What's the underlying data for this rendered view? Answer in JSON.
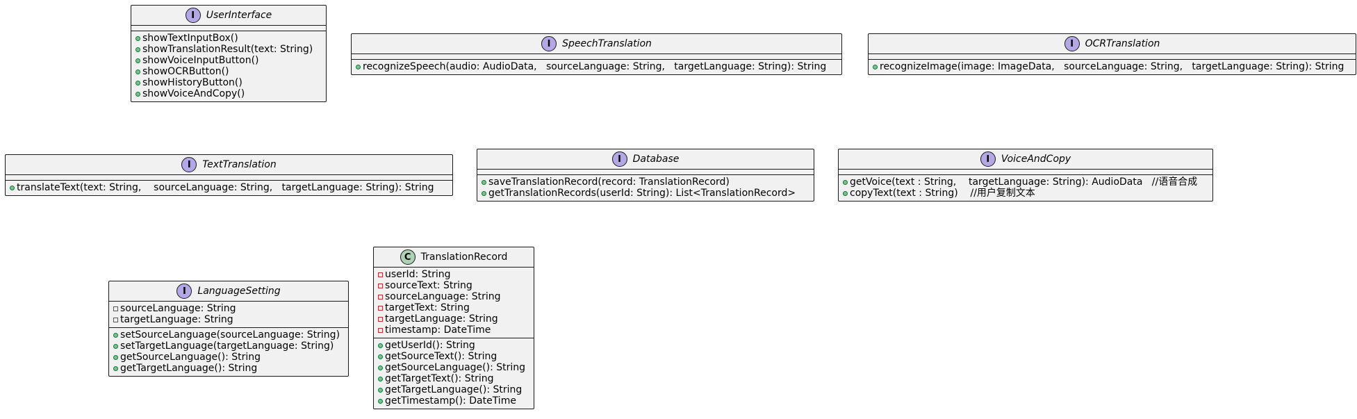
{
  "diagram": {
    "classes": [
      {
        "id": "user-interface",
        "kind": "interface",
        "stereotype_letter": "I",
        "name": "UserInterface",
        "attributes": [],
        "methods": [
          {
            "vis": "public",
            "text": "showTextInputBox()"
          },
          {
            "vis": "public",
            "text": "showTranslationResult(text: String)"
          },
          {
            "vis": "public",
            "text": "showVoiceInputButton()"
          },
          {
            "vis": "public",
            "text": "showOCRButton()"
          },
          {
            "vis": "public",
            "text": "showHistoryButton()"
          },
          {
            "vis": "public",
            "text": "showVoiceAndCopy()"
          }
        ]
      },
      {
        "id": "speech-translation",
        "kind": "interface",
        "stereotype_letter": "I",
        "name": "SpeechTranslation",
        "attributes": [],
        "methods": [
          {
            "vis": "public",
            "text": "recognizeSpeech(audio: AudioData,   sourceLanguage: String,   targetLanguage: String): String"
          }
        ]
      },
      {
        "id": "ocr-translation",
        "kind": "interface",
        "stereotype_letter": "I",
        "name": "OCRTranslation",
        "attributes": [],
        "methods": [
          {
            "vis": "public",
            "text": "recognizeImage(image: ImageData,   sourceLanguage: String,   targetLanguage: String): String"
          }
        ]
      },
      {
        "id": "text-translation",
        "kind": "interface",
        "stereotype_letter": "I",
        "name": "TextTranslation",
        "attributes": [],
        "methods": [
          {
            "vis": "public",
            "text": "translateText(text: String,    sourceLanguage: String,   targetLanguage: String): String"
          }
        ]
      },
      {
        "id": "database",
        "kind": "interface",
        "stereotype_letter": "I",
        "name": "Database",
        "attributes": [],
        "methods": [
          {
            "vis": "public",
            "text": "saveTranslationRecord(record: TranslationRecord)"
          },
          {
            "vis": "public",
            "text": "getTranslationRecords(userId: String): List<TranslationRecord>"
          }
        ]
      },
      {
        "id": "voice-and-copy",
        "kind": "interface",
        "stereotype_letter": "I",
        "name": "VoiceAndCopy",
        "attributes": [],
        "methods": [
          {
            "vis": "public",
            "text": "getVoice(text : String,    targetLanguage: String): AudioData   //语音合成"
          },
          {
            "vis": "public",
            "text": "copyText(text : String)    //用户复制文本"
          }
        ]
      },
      {
        "id": "language-setting",
        "kind": "interface",
        "stereotype_letter": "I",
        "name": "LanguageSetting",
        "attributes": [
          {
            "vis": "private",
            "text": "sourceLanguage: String"
          },
          {
            "vis": "private",
            "text": "targetLanguage: String"
          }
        ],
        "methods": [
          {
            "vis": "public",
            "text": "setSourceLanguage(sourceLanguage: String)"
          },
          {
            "vis": "public",
            "text": "setTargetLanguage(targetLanguage: String)"
          },
          {
            "vis": "public",
            "text": "getSourceLanguage(): String"
          },
          {
            "vis": "public",
            "text": "getTargetLanguage(): String"
          }
        ]
      },
      {
        "id": "translation-record",
        "kind": "class",
        "stereotype_letter": "C",
        "name": "TranslationRecord",
        "attributes": [
          {
            "vis": "private",
            "text": "userId: String"
          },
          {
            "vis": "private",
            "text": "sourceText: String"
          },
          {
            "vis": "private",
            "text": "sourceLanguage: String"
          },
          {
            "vis": "private",
            "text": "targetText: String"
          },
          {
            "vis": "private",
            "text": "targetLanguage: String"
          },
          {
            "vis": "private",
            "text": "timestamp: DateTime"
          }
        ],
        "methods": [
          {
            "vis": "public",
            "text": "getUserId(): String"
          },
          {
            "vis": "public",
            "text": "getSourceText(): String"
          },
          {
            "vis": "public",
            "text": "getSourceLanguage(): String"
          },
          {
            "vis": "public",
            "text": "getTargetText(): String"
          },
          {
            "vis": "public",
            "text": "getTargetLanguage(): String"
          },
          {
            "vis": "public",
            "text": "getTimestamp(): DateTime"
          }
        ]
      }
    ],
    "colors": {
      "box_fill": "#f1f1f1",
      "border": "#181818",
      "interface_marker": "#b4a7e5",
      "class_marker": "#add1b2",
      "public_marker": "#84be84",
      "private_marker": "#c82930"
    }
  }
}
